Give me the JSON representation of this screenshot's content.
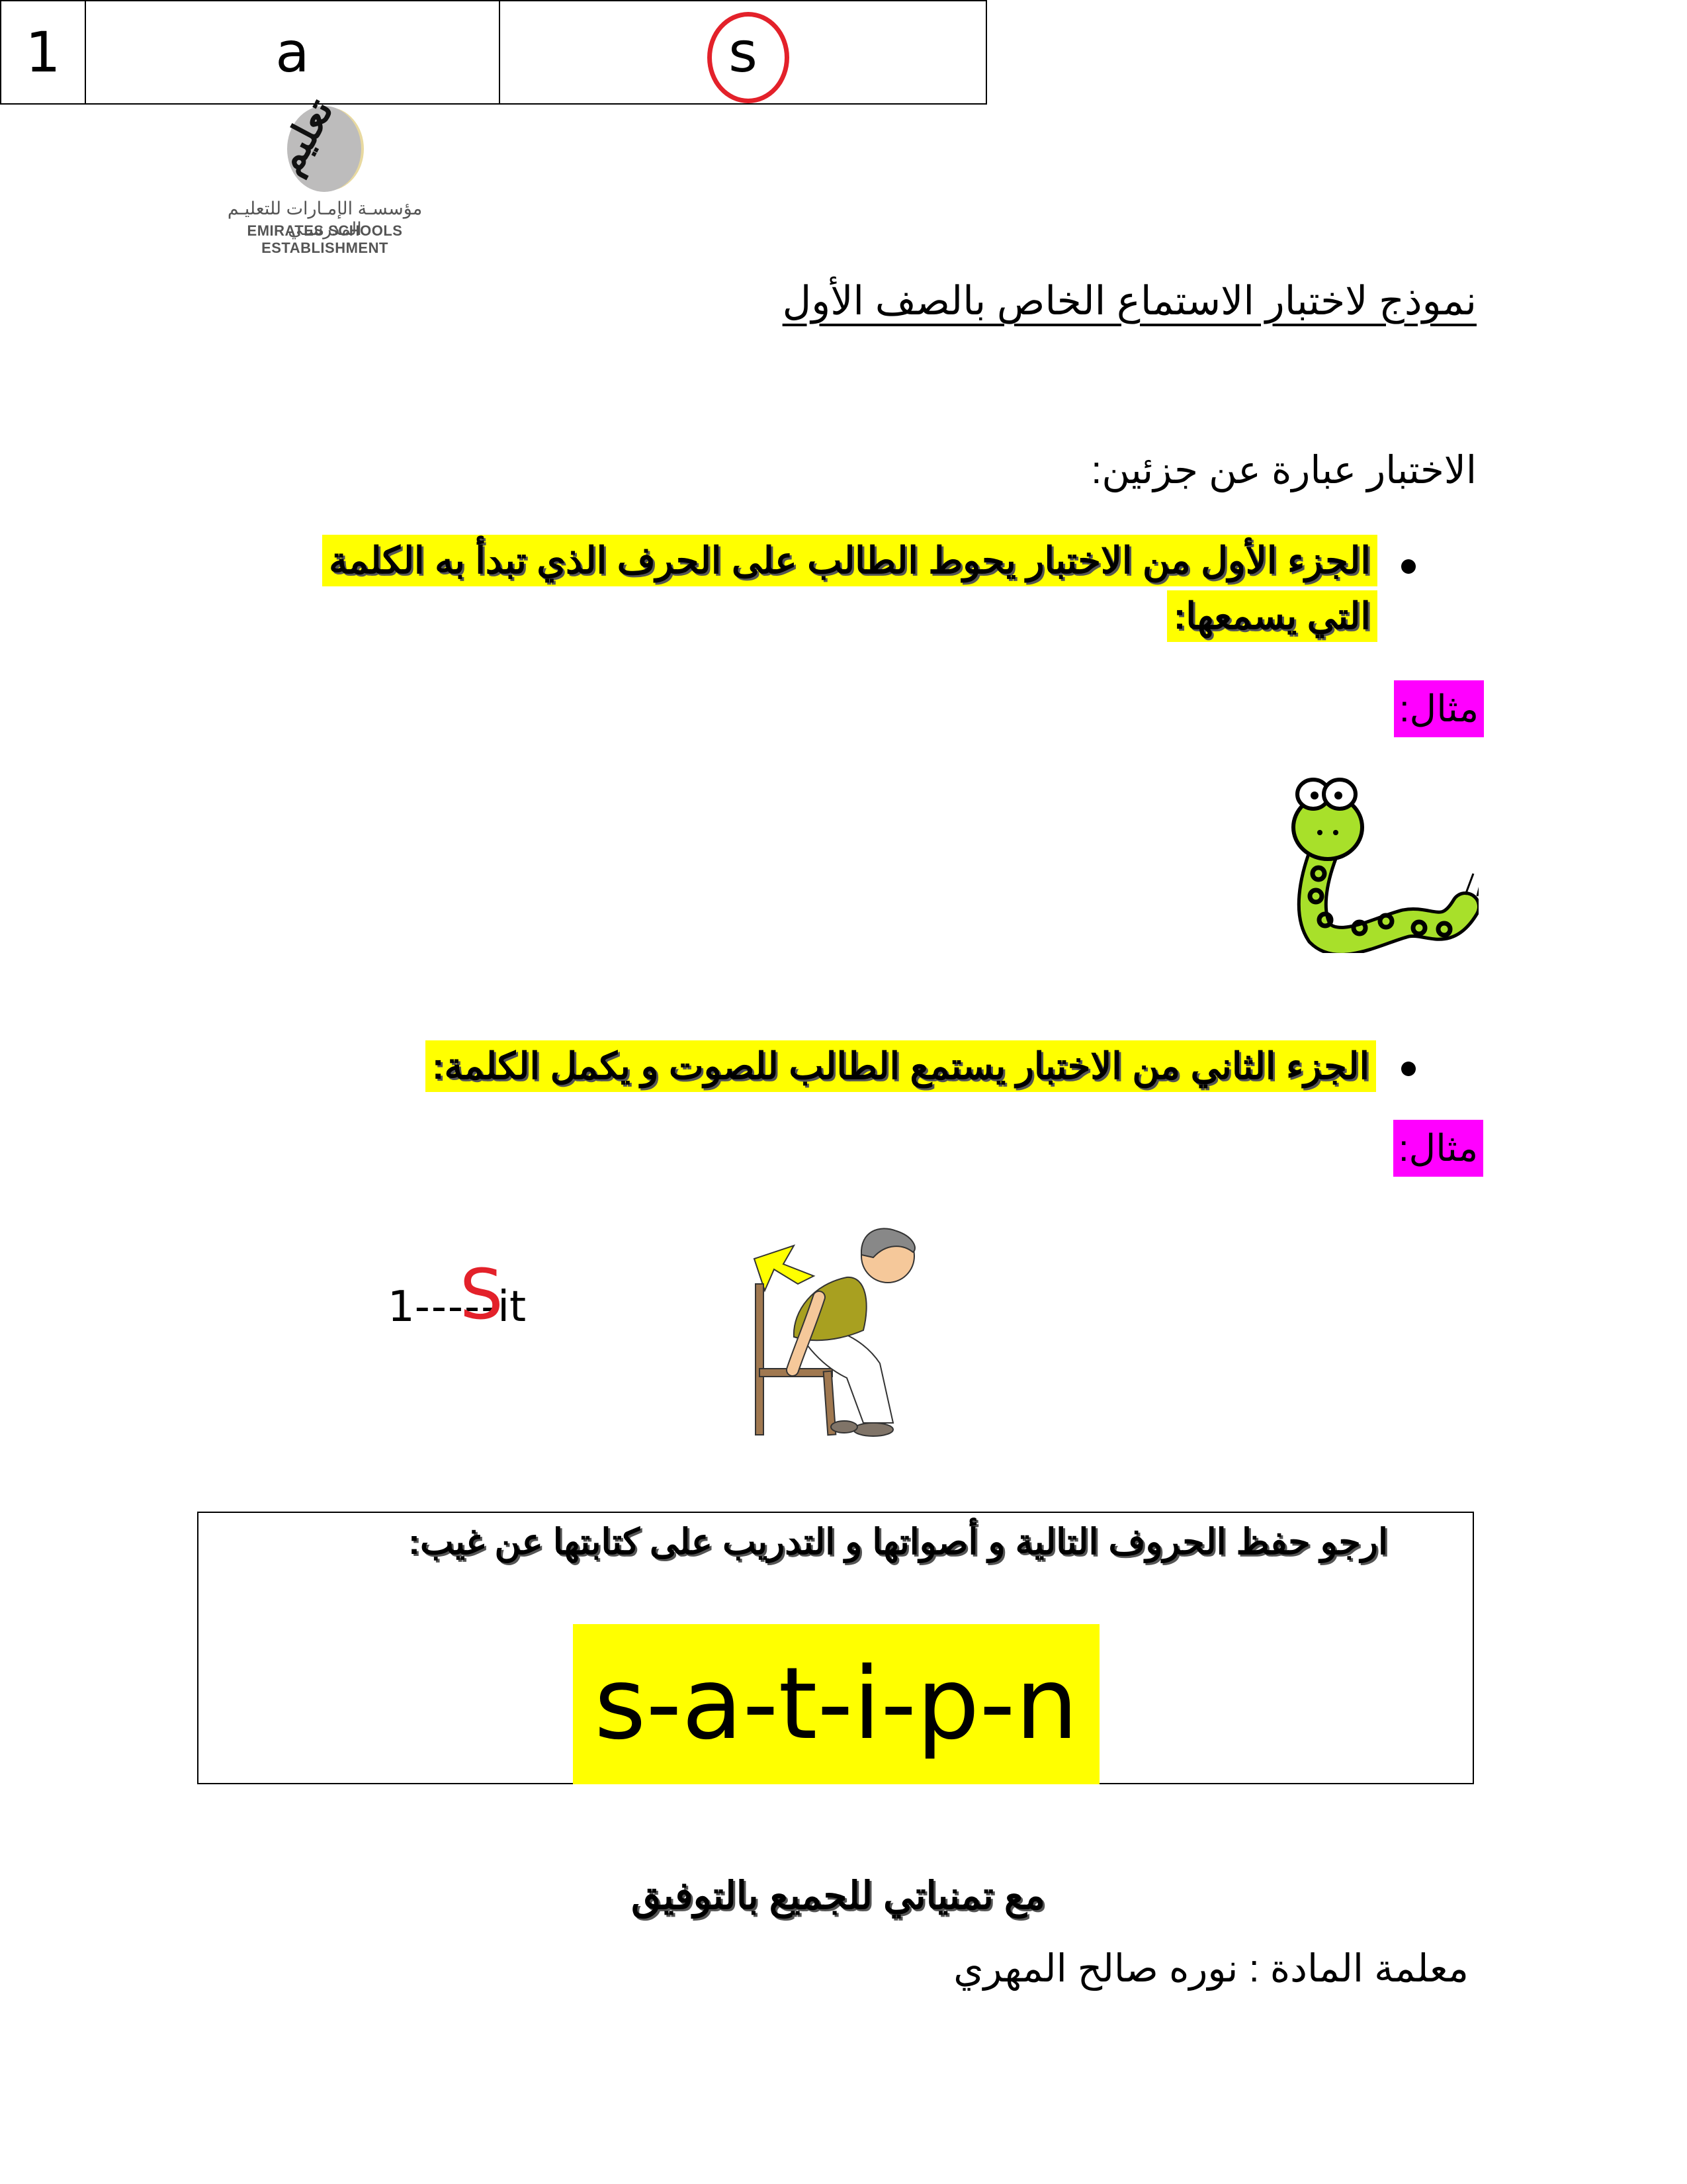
{
  "logo": {
    "calligraphy": "تعليم",
    "arabic_name": "مؤسسـة الإمـارات للتعليـم المدرسـي",
    "english_name": "EMIRATES SCHOOLS ESTABLISHMENT"
  },
  "title": "نموذج لاختبار الاستماع الخاص بالصف الأول",
  "intro": "الاختبار عبارة عن جزئين:",
  "part1": {
    "line1": "الجزء الأول من الاختبار يحوط الطالب على الحرف الذي تبدأ به الكلمة",
    "line2": "التي يسمعها:",
    "example_label": "مثال:",
    "example_row": {
      "number": "1",
      "option_a": "a",
      "option_s": "s",
      "circled": "s"
    },
    "image": "snake-icon"
  },
  "part2": {
    "line1": "الجزء الثاني من الاختبار يستمع الطالب للصوت و يكمل الكلمة:",
    "example_label": "مثال:",
    "example_word": {
      "prefix": "1",
      "blank": "-----",
      "answer": "S",
      "suffix": "it"
    },
    "image": "sitting-boy-icon"
  },
  "memorize_box": {
    "instruction": "ارجو حفظ الحروف التالية و أصواتها و التدريب على كتابتها عن غيب:",
    "letters": "s-a-t-i-p-n"
  },
  "footer": {
    "wishes": "مع تمنياتي للجميع بالتوفيق",
    "teacher": "معلمة المادة : نوره صالح المهري"
  },
  "colors": {
    "highlight_yellow": "#ffff00",
    "highlight_magenta": "#ff00ff",
    "annotation_red": "#e3212a"
  }
}
